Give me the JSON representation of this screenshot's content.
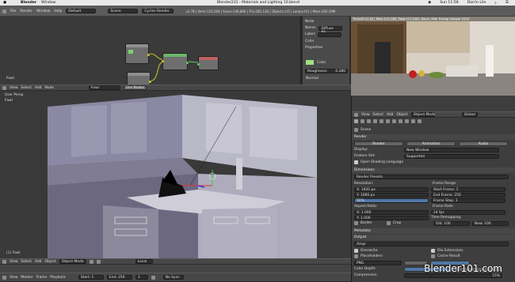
{
  "mac_menubar": {
    "app": "Blender",
    "window_menu": "Window",
    "title": "Blender231 - Materials and Lighting 10.blend",
    "time": "Sun 11:58",
    "user": "Darrin Lile"
  },
  "info_header": {
    "menus": [
      "File",
      "Render",
      "Window",
      "Help"
    ],
    "screen": "Default",
    "scene": "Scene",
    "engine": "Cycles Render",
    "stats": "v2.78 | Verts:153,560 | Faces:140,806 | Tris:285,128 | Objects:1/5 | Lamps:0/1 | Mem:292.19M"
  },
  "node_editor": {
    "panel": {
      "node_label": "Node",
      "name_label": "Name:",
      "name_value": "Diffuse BS...",
      "label_label": "Label:",
      "color_label": "Color",
      "properties_label": "Properties",
      "color_row_label": "Color",
      "roughness_label": "Roughness:",
      "roughness_value": "0.280",
      "normal_label": "Normal"
    },
    "footer_label": "Fowl"
  },
  "render_preview": {
    "header": "Time:00:12.42 | Mem:213.24M, Peak:213.24M | Done | Path Tracing Sample 10/10"
  },
  "viewport": {
    "header": {
      "menus": [
        "View",
        "Select",
        "Add",
        "Node"
      ],
      "mat": "Fowl",
      "use_nodes": "Use Nodes"
    },
    "overlay_top": "User Persp",
    "overlay_sub": "Fowl",
    "overlay_bottom": "(1) Fowl",
    "footer": {
      "menus": [
        "View",
        "Select",
        "Add",
        "Object"
      ],
      "mode": "Object Mode",
      "pivot": "Local"
    }
  },
  "properties": {
    "header_menus": [
      "View",
      "Select",
      "Add",
      "Object"
    ],
    "mode": "Object Mode",
    "global": "Global",
    "scene_label": "Scene",
    "render_panel": "Render",
    "render_btn": "Render",
    "animation_btn": "Animation",
    "audio_btn": "Audio",
    "display_label": "Display:",
    "display_value": "New Window",
    "feature_label": "Feature Set:",
    "feature_value": "Supported",
    "osl_label": "Open Shading Language",
    "dimensions_panel": "Dimensions",
    "presets": "Render Presets",
    "resolution_label": "Resolution:",
    "res_x": "X: 1920 px",
    "res_y": "Y: 1080 px",
    "res_pct": "50%",
    "frame_range_label": "Frame Range:",
    "start_frame": "Start Frame: 1",
    "end_frame": "End Frame: 250",
    "frame_step": "Frame Step: 1",
    "aspect_label": "Aspect Ratio:",
    "aspect_x": "X: 1.000",
    "aspect_y": "Y: 1.000",
    "fps_label": "Frame Rate:",
    "fps_value": "24 fps",
    "time_remap_label": "Time Remapping:",
    "old": "Old: 100",
    "new": "New: 100",
    "border": "Border",
    "crop": "Crop",
    "metadata": "Metadata",
    "output": "Output",
    "output_path": "/tmp/",
    "overwrite": "Overwrite",
    "file_ext": "File Extensions",
    "placeholders": "Placeholders",
    "cache_result": "Cache Result",
    "format": "PNG",
    "color_depth": "Color Depth:",
    "compression": "Compression:",
    "compression_value": "15%"
  },
  "timeline": {
    "menus": [
      "View",
      "Marker",
      "Frame",
      "Playback"
    ],
    "start": "Start: 1",
    "end": "End: 250",
    "current": "1",
    "sync": "No Sync"
  },
  "watermark": "Blender101.com"
}
